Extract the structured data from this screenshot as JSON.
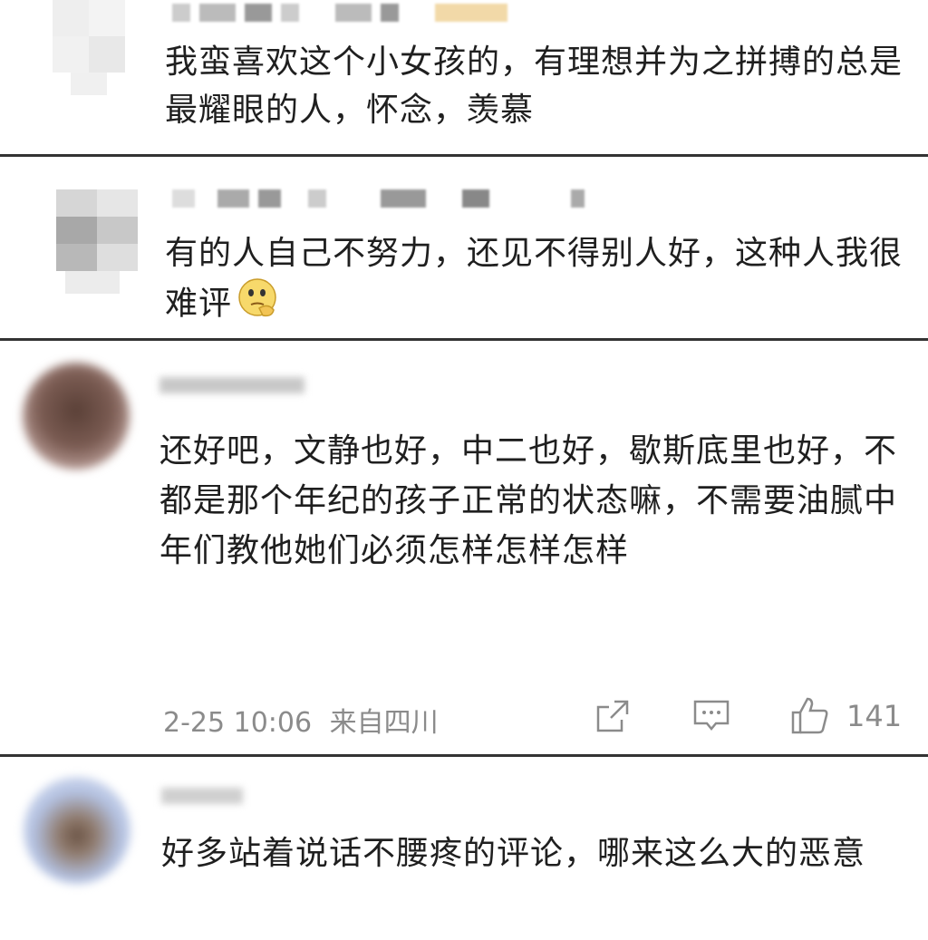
{
  "comments": [
    {
      "text": "我蛮喜欢这个小女孩的，有理想并为之拼搏的总是最耀眼的人，怀念，羡慕"
    },
    {
      "text": "有的人自己不努力，还见不得别人好，这种人我很难评"
    },
    {
      "text": "还好吧，文静也好，中二也好，歇斯底里也好，不都是那个年纪的孩子正常的状态嘛，不需要油腻中年们教他她们必须怎样怎样怎样",
      "timestamp": "2-25 10:06",
      "location": "来自四川",
      "likes": "141"
    },
    {
      "text": "好多站着说话不腰疼的评论，哪来这么大的恶意"
    }
  ],
  "icons": {
    "emoji": "thinking-face-emoji",
    "share": "share-icon",
    "reply": "comment-icon",
    "like": "thumbs-up-icon"
  },
  "colors": {
    "meta": "#8b8b8b",
    "divider": "#333333",
    "text": "#1f1f1f"
  }
}
